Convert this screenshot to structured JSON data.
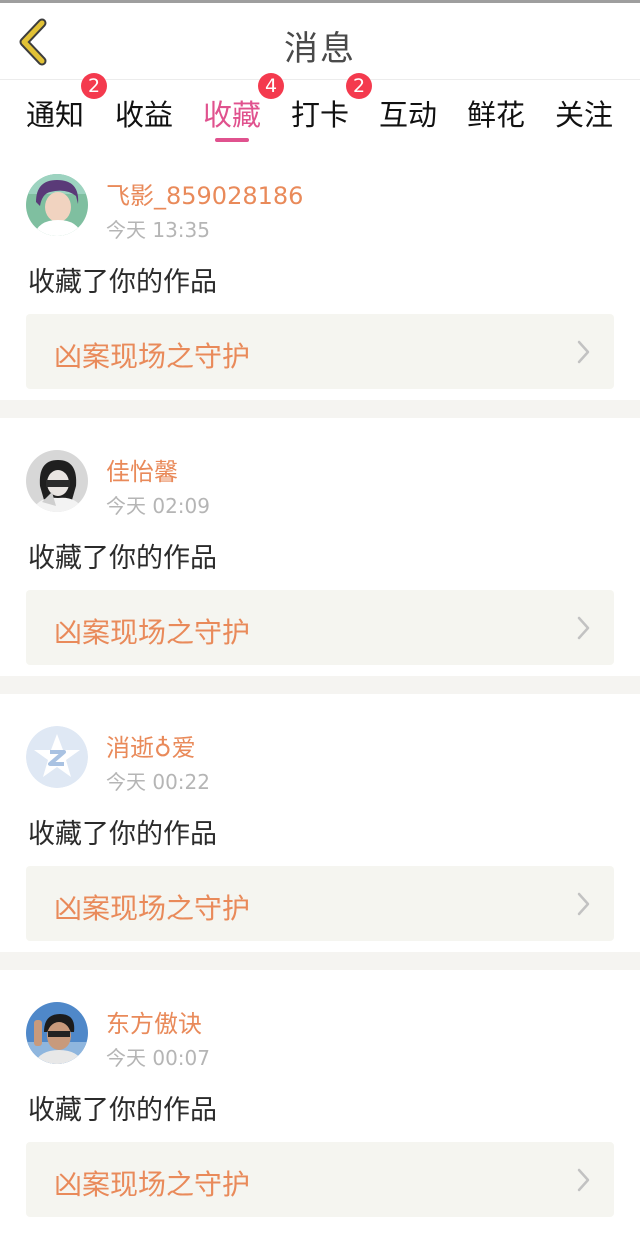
{
  "header": {
    "title": "消息",
    "back_icon": "chevron-left-icon",
    "accent": "#e2c236"
  },
  "tabs": [
    {
      "label": "通知",
      "badge": "2"
    },
    {
      "label": "收益",
      "badge": ""
    },
    {
      "label": "收藏",
      "badge": "4",
      "active": true
    },
    {
      "label": "打卡",
      "badge": "2"
    },
    {
      "label": "互动",
      "badge": ""
    },
    {
      "label": "鲜花",
      "badge": ""
    },
    {
      "label": "关注",
      "badge": ""
    }
  ],
  "colors": {
    "active_tab": "#e0528e",
    "badge": "#f43a4e",
    "name": "#e98a5a",
    "work_title": "#e98a5a",
    "card_bg": "#f5f5f0"
  },
  "feed": [
    {
      "user": "飞影_859028186",
      "time": "今天 13:35",
      "action": "收藏了你的作品",
      "work": "凶案现场之守护",
      "avatar": "avatar-photo"
    },
    {
      "user": "佳怡馨",
      "time": "今天 02:09",
      "action": "收藏了你的作品",
      "work": "凶案现场之守护",
      "avatar": "avatar-photo"
    },
    {
      "user": "消逝♁爱",
      "time": "今天 00:22",
      "action": "收藏了你的作品",
      "work": "凶案现场之守护",
      "avatar": "default-star-avatar-icon"
    },
    {
      "user": "东方傲诀",
      "time": "今天 00:07",
      "action": "收藏了你的作品",
      "work": "凶案现场之守护",
      "avatar": "avatar-photo"
    }
  ]
}
